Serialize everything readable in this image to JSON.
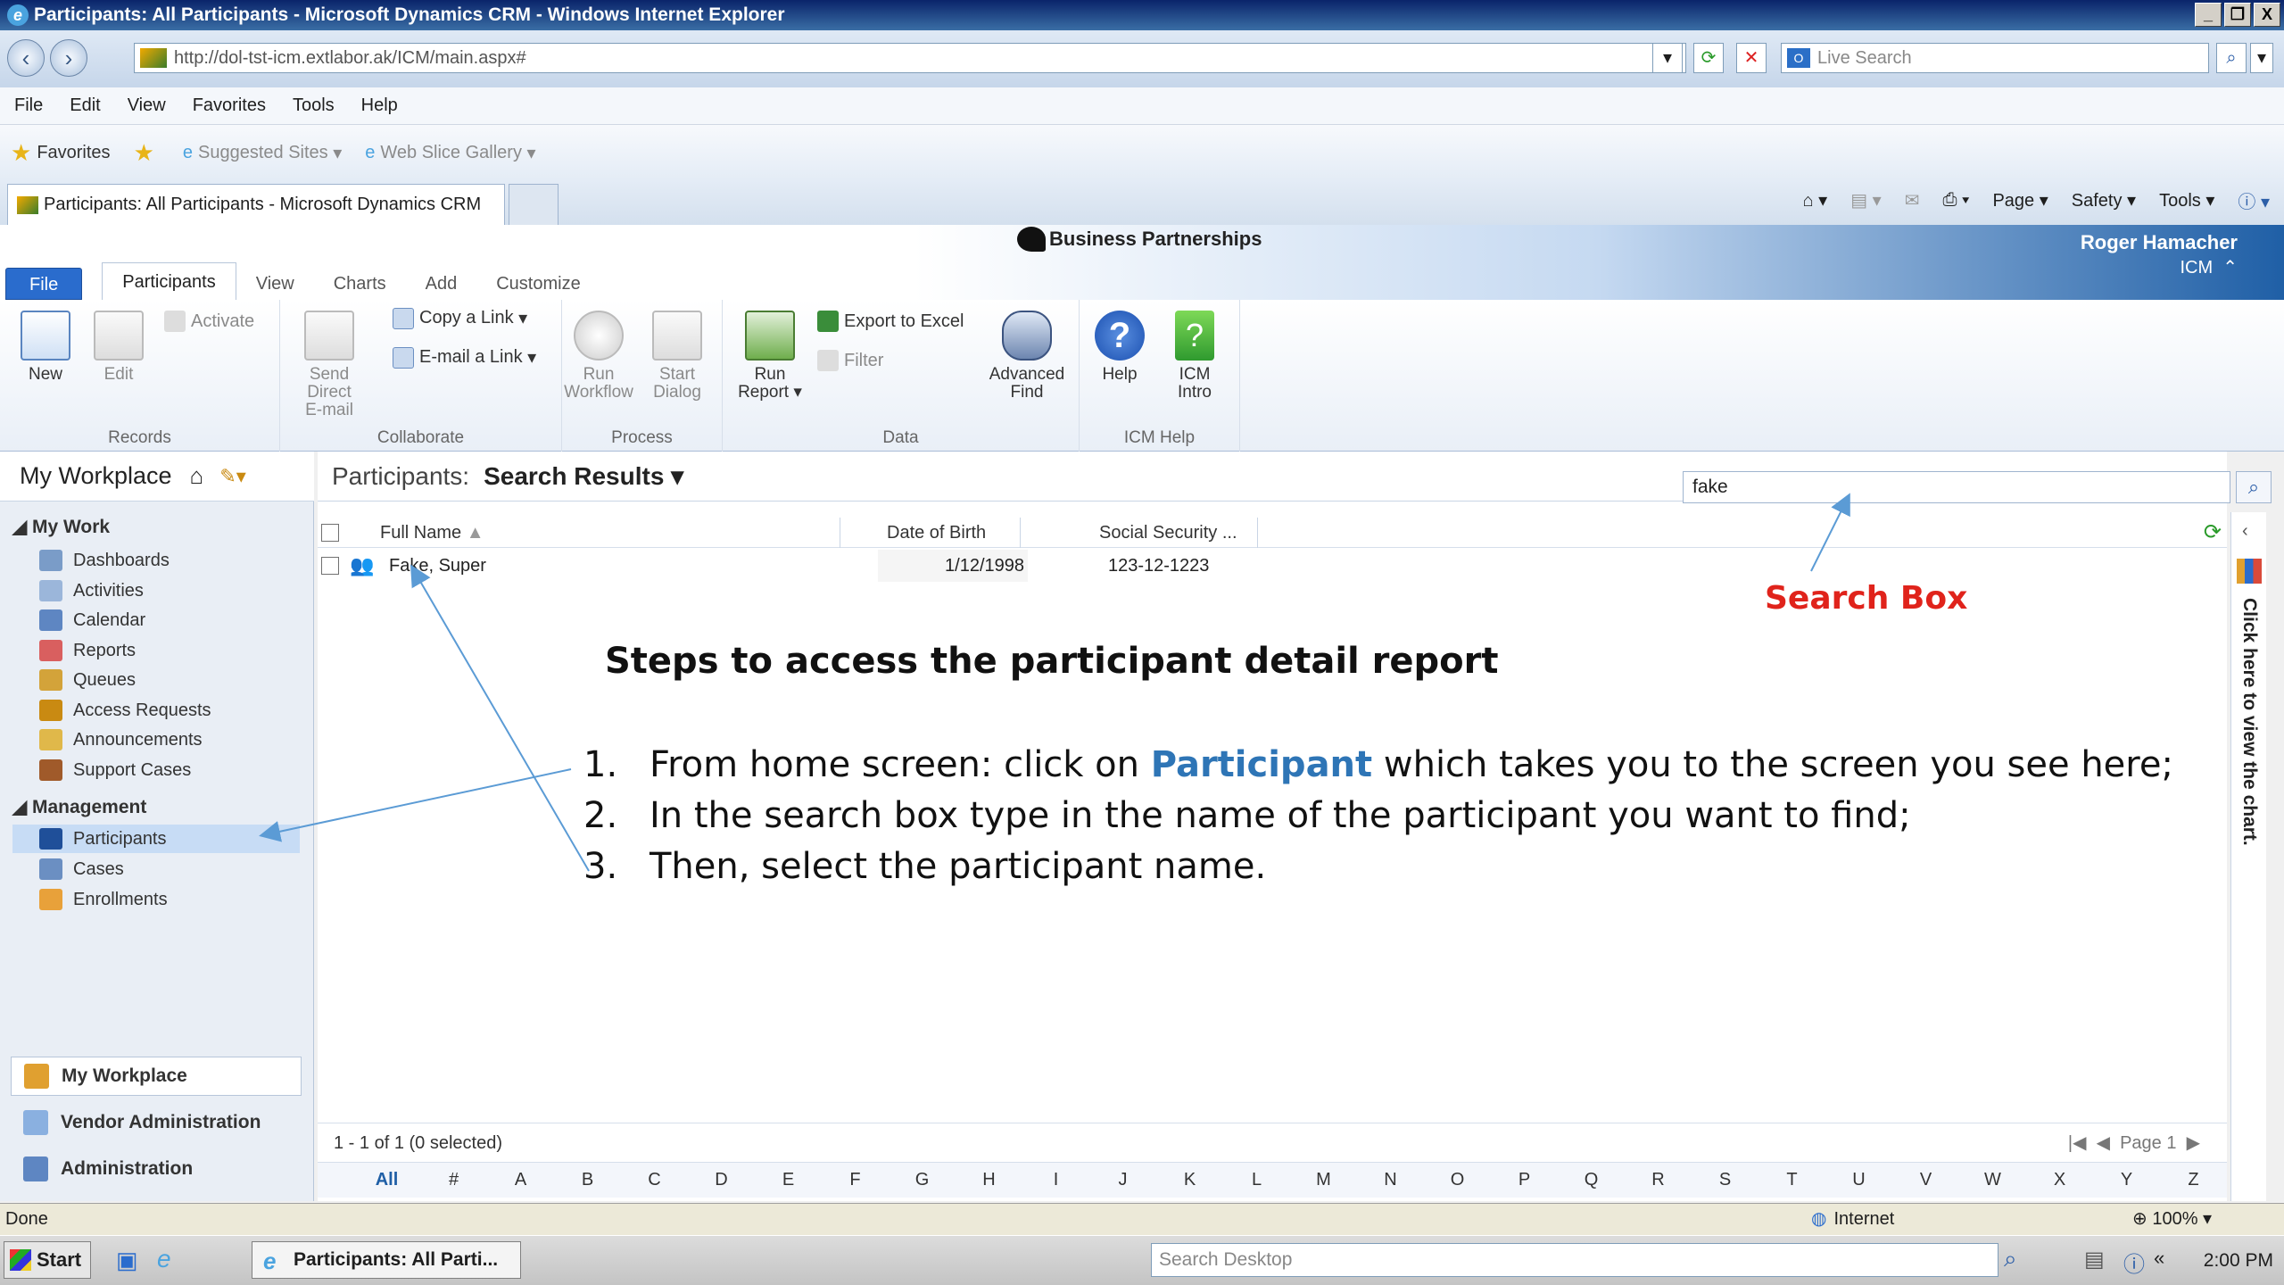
{
  "window": {
    "title": "Participants: All Participants - Microsoft Dynamics CRM - Windows Internet Explorer",
    "controls": [
      "_",
      "❐",
      "X"
    ]
  },
  "address": {
    "url": "http://dol-tst-icm.extlabor.ak/ICM/main.aspx#",
    "live_search_placeholder": "Live Search"
  },
  "menu": [
    "File",
    "Edit",
    "View",
    "Favorites",
    "Tools",
    "Help"
  ],
  "favorites": {
    "label": "Favorites",
    "suggested": "Suggested Sites",
    "webslice": "Web Slice Gallery"
  },
  "tab": {
    "title": "Participants: All Participants - Microsoft Dynamics CRM",
    "commands": [
      "Page",
      "Safety",
      "Tools"
    ]
  },
  "crm": {
    "brand": "Business Partnerships",
    "user_name": "Roger Hamacher",
    "org": "ICM",
    "ribbon_tabs": [
      "File",
      "Participants",
      "View",
      "Charts",
      "Add",
      "Customize"
    ]
  },
  "ribbon": {
    "records": {
      "label": "Records",
      "new": "New",
      "edit": "Edit",
      "activate": "Activate"
    },
    "collaborate": {
      "label": "Collaborate",
      "send_direct_email_1": "Send Direct",
      "send_direct_email_2": "E-mail",
      "copy_link": "Copy a Link",
      "email_link": "E-mail a Link"
    },
    "process": {
      "label": "Process",
      "run_workflow_1": "Run",
      "run_workflow_2": "Workflow",
      "start_dialog_1": "Start",
      "start_dialog_2": "Dialog"
    },
    "data": {
      "label": "Data",
      "run_report_1": "Run",
      "run_report_2": "Report",
      "export_excel": "Export to Excel",
      "filter": "Filter",
      "advanced_find_1": "Advanced",
      "advanced_find_2": "Find"
    },
    "icm_help": {
      "label": "ICM Help",
      "help": "Help",
      "icm_intro_1": "ICM",
      "icm_intro_2": "Intro"
    }
  },
  "nav": {
    "workplace_title": "My Workplace",
    "my_work_label": "My Work",
    "my_work": [
      "Dashboards",
      "Activities",
      "Calendar",
      "Reports",
      "Queues",
      "Access Requests",
      "Announcements",
      "Support Cases"
    ],
    "management_label": "Management",
    "management": [
      "Participants",
      "Cases",
      "Enrollments"
    ],
    "bottom": [
      "My Workplace",
      "Vendor Administration",
      "Administration"
    ]
  },
  "view": {
    "entity": "Participants:",
    "name": "Search Results",
    "search_value": "fake",
    "columns": [
      "Full Name",
      "Date of Birth",
      "Social Security ..."
    ],
    "rows": [
      {
        "name": "Fake, Super",
        "dob": "1/12/1998",
        "ssn": "123-12-1223"
      }
    ],
    "footer": "1 - 1 of 1 (0 selected)",
    "page": "Page 1",
    "alpha": [
      "All",
      "#",
      "A",
      "B",
      "C",
      "D",
      "E",
      "F",
      "G",
      "H",
      "I",
      "J",
      "K",
      "L",
      "M",
      "N",
      "O",
      "P",
      "Q",
      "R",
      "S",
      "T",
      "U",
      "V",
      "W",
      "X",
      "Y",
      "Z"
    ],
    "chart_hint": "Click here to view the chart."
  },
  "annotation": {
    "title": "Steps to access the participant detail report",
    "search_box_label": "Search Box",
    "steps": [
      {
        "num": "1.",
        "before": "From home screen: click on ",
        "highlight": "Participant",
        "after": "  which takes you to the screen you see here;"
      },
      {
        "num": "2.",
        "text": "In the search box type in the name of the participant you want to find;"
      },
      {
        "num": "3.",
        "text": "Then, select the participant name."
      }
    ]
  },
  "status": {
    "text": "Done",
    "zone": "Internet",
    "zoom": "100%"
  },
  "taskbar": {
    "start": "Start",
    "task": "Participants: All Parti...",
    "search_placeholder": "Search Desktop",
    "time": "2:00 PM"
  },
  "colors": {
    "accent": "#1f5fa6",
    "annotation_red": "#e0231b",
    "annotation_blue": "#2e75b6",
    "selected_nav": "#c7dcf5"
  }
}
